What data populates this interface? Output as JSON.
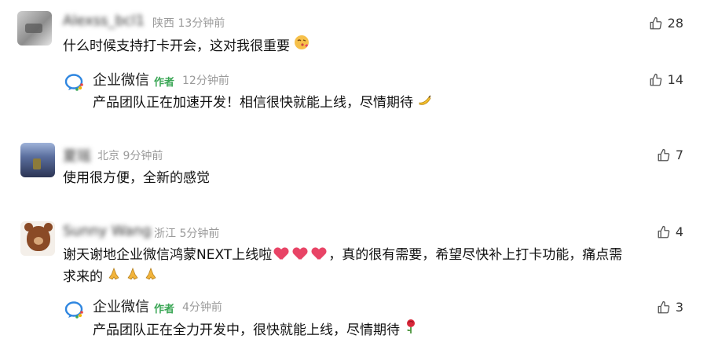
{
  "comments": [
    {
      "user": "Alexss_bcl1",
      "location": "陕西",
      "time": "13分钟前",
      "text": "什么时候支持打卡开会，这对我很重要",
      "likes": "28",
      "reply": {
        "user": "企业微信",
        "tag": "作者",
        "time": "12分钟前",
        "text": "产品团队正在加速开发！相信很快就能上线，尽情期待",
        "likes": "14"
      }
    },
    {
      "user": "夏瑶",
      "location": "北京",
      "time": "9分钟前",
      "text": "使用很方便，全新的感觉",
      "likes": "7"
    },
    {
      "user": "Sunny Wang",
      "location": "浙江",
      "time": "5分钟前",
      "text_line1_a": "谢天谢地企业微信鸿蒙NEXT上线啦",
      "text_line1_b": "，真的很有需要，希望尽快补上打卡功能，痛点需",
      "text_line2": "求来的",
      "likes": "4",
      "reply": {
        "user": "企业微信",
        "tag": "作者",
        "time": "4分钟前",
        "text": "产品团队正在全力开发中，很快就能上线，尽情期待",
        "likes": "3"
      }
    }
  ]
}
